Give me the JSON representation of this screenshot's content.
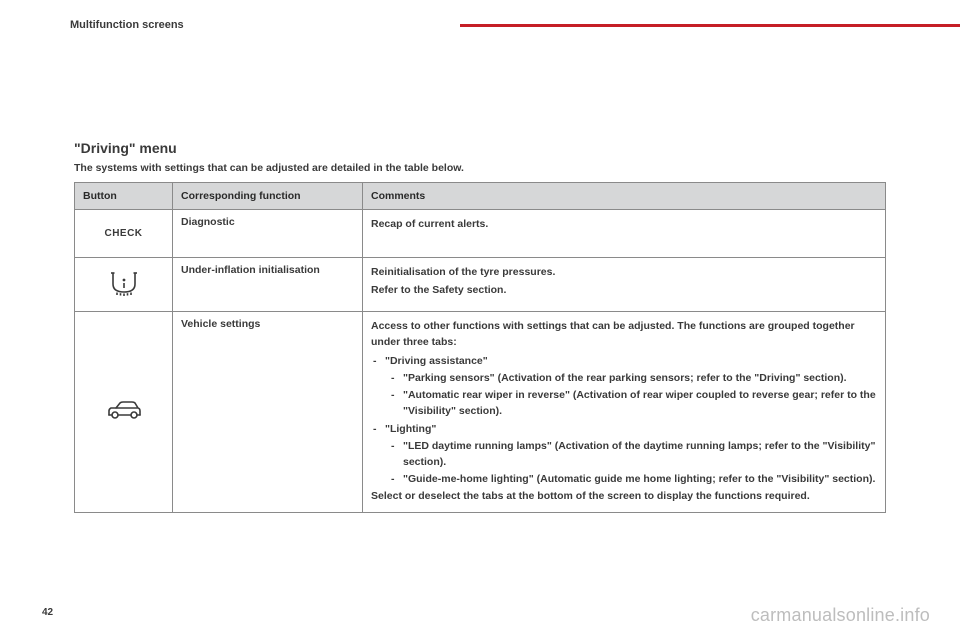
{
  "header": {
    "section": "Multifunction screens"
  },
  "page_number": "42",
  "watermark": "carmanualsonline.info",
  "menu": {
    "title": "\"Driving\" menu",
    "intro": "The systems with settings that can be adjusted are detailed in the table below."
  },
  "table": {
    "headers": {
      "button": "Button",
      "function": "Corresponding function",
      "comments": "Comments"
    },
    "rows": [
      {
        "button_label": "CHECK",
        "function": "Diagnostic",
        "comments_plain": "Recap of current alerts."
      },
      {
        "icon_name": "tyre-pressure-icon",
        "function": "Under-inflation initialisation",
        "comments_line1": "Reinitialisation of the tyre pressures.",
        "comments_line2": "Refer to the Safety section."
      },
      {
        "icon_name": "car-icon",
        "function": "Vehicle settings",
        "comments_intro": "Access to other functions with settings that can be adjusted. The functions are grouped together under three tabs:",
        "tab1_label": "\"Driving assistance\"",
        "tab1_item1": "\"Parking sensors\" (Activation of the rear parking sensors; refer to the \"Driving\" section).",
        "tab1_item2": "\"Automatic rear wiper in reverse\" (Activation of rear wiper coupled to reverse gear; refer to the \"Visibility\" section).",
        "tab2_label": "\"Lighting\"",
        "tab2_item1": "\"LED daytime running lamps\" (Activation of the daytime running lamps; refer to the \"Visibility\" section).",
        "tab2_item2": "\"Guide-me-home lighting\" (Automatic guide me home lighting; refer to the \"Visibility\" section).",
        "comments_footer": "Select or deselect the tabs at the bottom of the screen to display the functions required."
      }
    ]
  }
}
